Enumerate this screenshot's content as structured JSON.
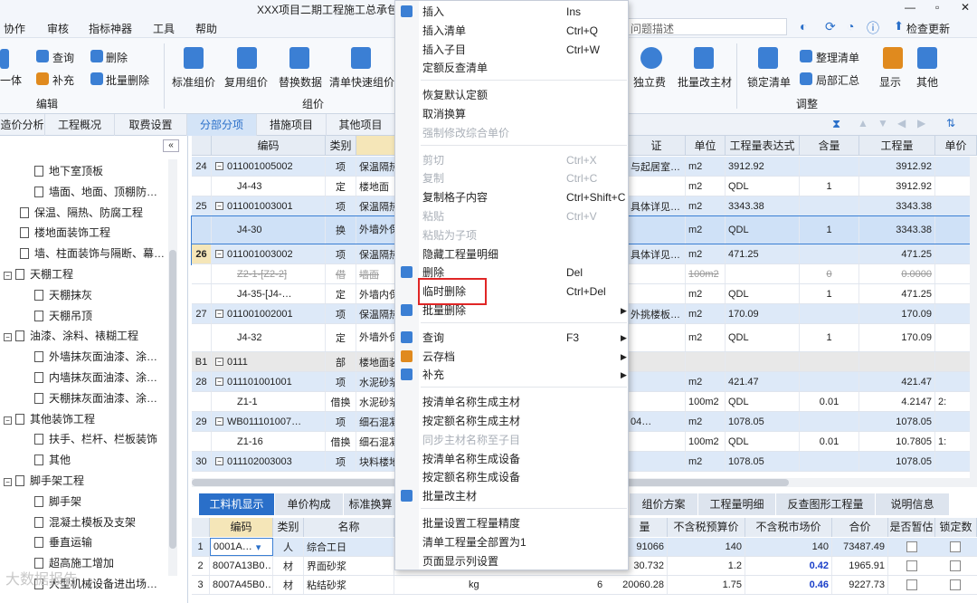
{
  "title": "XXX项目二期工程施工总承包",
  "window_controls": [
    "—",
    "▫",
    "✕"
  ],
  "menubar": {
    "items": [
      "协作",
      "审核",
      "指标神器",
      "工具",
      "帮助"
    ],
    "search_placeholder": "问题描述",
    "check_update": "检查更新"
  },
  "ribbon": {
    "left_group": {
      "query": "查询",
      "delete": "删除",
      "supplement": "补充",
      "batch_delete": "批量删除",
      "one_body": "一体",
      "label": "编辑"
    },
    "mid_group": {
      "std_price": "标准组价",
      "reuse_price": "复用组价",
      "replace_data": "替换数据",
      "quick_price": "清单快速组价",
      "label": "组价"
    },
    "right_group": {
      "independent_fee": "独立费",
      "batch_material": "批量改主材",
      "lock_list": "锁定清单",
      "organize_list": "整理清单",
      "partial_summary": "局部汇总",
      "display": "显示",
      "other": "其他",
      "label": "调整"
    }
  },
  "tabs": [
    "造价分析",
    "工程概况",
    "取费设置",
    "分部分项",
    "措施项目",
    "其他项目"
  ],
  "active_tab": "分部分项",
  "tree": [
    {
      "label": "地下室顶板",
      "level": 2
    },
    {
      "label": "墙面、地面、顶棚防…",
      "level": 2
    },
    {
      "label": "保温、隔热、防腐工程",
      "level": 1
    },
    {
      "label": "楼地面装饰工程",
      "level": 1
    },
    {
      "label": "墙、柱面装饰与隔断、幕…",
      "level": 1
    },
    {
      "label": "天棚工程",
      "level": 0,
      "collapse": "−"
    },
    {
      "label": "天棚抹灰",
      "level": 2
    },
    {
      "label": "天棚吊顶",
      "level": 2
    },
    {
      "label": "油漆、涂料、裱糊工程",
      "level": 0,
      "collapse": "−"
    },
    {
      "label": "外墙抹灰面油漆、涂…",
      "level": 2
    },
    {
      "label": "内墙抹灰面油漆、涂…",
      "level": 2
    },
    {
      "label": "天棚抹灰面油漆、涂…",
      "level": 2
    },
    {
      "label": "其他装饰工程",
      "level": 0,
      "collapse": "−"
    },
    {
      "label": "扶手、栏杆、栏板装饰",
      "level": 2
    },
    {
      "label": "其他",
      "level": 2
    },
    {
      "label": "脚手架工程",
      "level": 0,
      "collapse": "−"
    },
    {
      "label": "脚手架",
      "level": 2
    },
    {
      "label": "混凝土模板及支架",
      "level": 2
    },
    {
      "label": "垂直运输",
      "level": 2
    },
    {
      "label": "超高施工增加",
      "level": 2
    },
    {
      "label": "大型机械设备进出场…",
      "level": 2
    }
  ],
  "grid": {
    "headers": [
      "编码",
      "类别",
      "证",
      "单位",
      "工程量表达式",
      "含量",
      "工程量",
      "单价"
    ],
    "rows": [
      {
        "no": "24",
        "code": "011001005002",
        "type": "项",
        "name": "保温隔热",
        "spec": "与起居室…",
        "unit": "m2",
        "expr": "3912.92",
        "qty_ratio": "",
        "qty": "3912.92",
        "kind": "item",
        "box": "−"
      },
      {
        "no": "",
        "code": "J4-43",
        "type": "定",
        "name": "楼地面",
        "spec": "",
        "unit": "m2",
        "expr": "QDL",
        "qty_ratio": "1",
        "qty": "3912.92",
        "kind": "quota"
      },
      {
        "no": "25",
        "code": "011001003001",
        "type": "项",
        "name": "保温隔热",
        "spec": "具体详见…",
        "unit": "m2",
        "expr": "3343.38",
        "qty_ratio": "",
        "qty": "3343.38",
        "kind": "item",
        "box": "−"
      },
      {
        "no": "",
        "code": "J4-30",
        "type": "换",
        "name": "外墙外保温 格布 单",
        "spec": "",
        "unit": "m2",
        "expr": "QDL",
        "qty_ratio": "1",
        "qty": "3343.38",
        "kind": "selected"
      },
      {
        "no": "26",
        "code": "011001003002",
        "type": "项",
        "name": "保温隔热",
        "spec": "具体详见…",
        "unit": "m2",
        "expr": "471.25",
        "qty_ratio": "",
        "qty": "471.25",
        "kind": "item-current",
        "box": "−"
      },
      {
        "no": "",
        "code": "Z2-1-[Z2-2]",
        "type": "借",
        "name": "墙面",
        "spec": "",
        "unit": "100m2",
        "expr": "",
        "qty_ratio": "0",
        "qty": "0.0000",
        "kind": "struck"
      },
      {
        "no": "",
        "code": "J4-35-[J4-…",
        "type": "定",
        "name": "外墙内保",
        "spec": "",
        "unit": "m2",
        "expr": "QDL",
        "qty_ratio": "1",
        "qty": "471.25",
        "kind": "quota"
      },
      {
        "no": "27",
        "code": "011001002001",
        "type": "项",
        "name": "保温隔热",
        "spec": "外挑楼板…",
        "unit": "m2",
        "expr": "170.09",
        "qty_ratio": "",
        "qty": "170.09",
        "kind": "item",
        "box": "−"
      },
      {
        "no": "",
        "code": "J4-32",
        "type": "定",
        "name": "外墙外保温 电焊网",
        "spec": "",
        "unit": "m2",
        "expr": "QDL",
        "qty_ratio": "1",
        "qty": "170.09",
        "kind": "quota-tall"
      },
      {
        "no": "B1",
        "code": "0111",
        "type": "部",
        "name": "楼地面装",
        "spec": "",
        "unit": "",
        "expr": "",
        "qty_ratio": "",
        "qty": "",
        "kind": "section",
        "box": "−"
      },
      {
        "no": "28",
        "code": "011101001001",
        "type": "项",
        "name": "水泥砂浆",
        "spec": "",
        "unit": "m2",
        "expr": "421.47",
        "qty_ratio": "",
        "qty": "421.47",
        "kind": "item",
        "box": "−"
      },
      {
        "no": "",
        "code": "Z1-1",
        "type": "借换",
        "name": "水泥砂浆",
        "spec": "",
        "unit": "100m2",
        "expr": "QDL",
        "qty_ratio": "0.01",
        "qty": "4.2147",
        "kind": "quota",
        "extra": "2:"
      },
      {
        "no": "29",
        "code": "WB011101007…",
        "type": "项",
        "name": "细石混凝",
        "spec": "04…",
        "unit": "m2",
        "expr": "1078.05",
        "qty_ratio": "",
        "qty": "1078.05",
        "kind": "item",
        "box": "−"
      },
      {
        "no": "",
        "code": "Z1-16",
        "type": "借换",
        "name": "细石混凝",
        "spec": "",
        "unit": "100m2",
        "expr": "QDL",
        "qty_ratio": "0.01",
        "qty": "10.7805",
        "kind": "quota",
        "extra": "1:"
      },
      {
        "no": "30",
        "code": "011102003003",
        "type": "项",
        "name": "块料楼地",
        "spec": "",
        "unit": "m2",
        "expr": "1078.05",
        "qty_ratio": "",
        "qty": "1078.05",
        "kind": "item",
        "box": "−"
      }
    ]
  },
  "context_menu": {
    "items": [
      {
        "label": "插入",
        "shortcut": "Ins",
        "icon": "insert-icon"
      },
      {
        "label": "插入清单",
        "shortcut": "Ctrl+Q"
      },
      {
        "label": "插入子目",
        "shortcut": "Ctrl+W"
      },
      {
        "label": "定额反查清单",
        "shortcut": ""
      },
      {
        "sep": true
      },
      {
        "label": "恢复默认定额",
        "shortcut": ""
      },
      {
        "label": "取消换算",
        "shortcut": ""
      },
      {
        "label": "强制修改综合单价",
        "shortcut": "",
        "disabled": true
      },
      {
        "sep": true
      },
      {
        "label": "剪切",
        "shortcut": "Ctrl+X",
        "disabled": true
      },
      {
        "label": "复制",
        "shortcut": "Ctrl+C",
        "disabled": true
      },
      {
        "label": "复制格子内容",
        "shortcut": "Ctrl+Shift+C"
      },
      {
        "label": "粘贴",
        "shortcut": "Ctrl+V",
        "disabled": true
      },
      {
        "label": "粘贴为子项",
        "shortcut": "",
        "disabled": true
      },
      {
        "label": "隐藏工程量明细",
        "shortcut": ""
      },
      {
        "label": "删除",
        "shortcut": "Del",
        "icon": "delete-icon"
      },
      {
        "label": "临时删除",
        "shortcut": "Ctrl+Del",
        "highlight": true
      },
      {
        "label": "批量删除",
        "shortcut": "",
        "submenu": true,
        "icon": "batch-delete-icon"
      },
      {
        "sep": true
      },
      {
        "label": "查询",
        "shortcut": "F3",
        "submenu": true,
        "icon": "query-icon"
      },
      {
        "label": "云存档",
        "shortcut": "",
        "submenu": true,
        "icon": "cloud-archive-icon"
      },
      {
        "label": "补充",
        "shortcut": "",
        "submenu": true,
        "icon": "supplement-icon"
      },
      {
        "sep": true
      },
      {
        "label": "按清单名称生成主材",
        "shortcut": ""
      },
      {
        "label": "按定额名称生成主材",
        "shortcut": ""
      },
      {
        "label": "同步主材名称至子目",
        "shortcut": "",
        "disabled": true
      },
      {
        "label": "按清单名称生成设备",
        "shortcut": ""
      },
      {
        "label": "按定额名称生成设备",
        "shortcut": ""
      },
      {
        "label": "批量改主材",
        "shortcut": "",
        "icon": "batch-material-icon"
      },
      {
        "sep": true
      },
      {
        "label": "批量设置工程量精度",
        "shortcut": ""
      },
      {
        "label": "清单工程量全部置为1",
        "shortcut": ""
      },
      {
        "label": "页面显示列设置",
        "shortcut": ""
      }
    ]
  },
  "bottom": {
    "tabs": [
      "工料机显示",
      "单价构成",
      "标准换算",
      "组价方案",
      "工程量明细",
      "反查图形工程量",
      "说明信息"
    ],
    "active_tab": "工料机显示",
    "headers": [
      "编码",
      "类别",
      "名称",
      "量",
      "不含税预算价",
      "不含税市场价",
      "合价",
      "是否暂估",
      "锁定数量"
    ],
    "rows": [
      {
        "no": "1",
        "code": "0001A…",
        "type": "人",
        "name": "综合工日",
        "unit": "",
        "qty": "91066",
        "budget": "140",
        "market": "140",
        "total": "73487.49"
      },
      {
        "no": "2",
        "code": "8007A13B0…",
        "type": "材",
        "name": "界面砂浆",
        "unit": "",
        "qty": "30.732",
        "budget": "1.2",
        "market": "0.42",
        "total": "1965.91"
      },
      {
        "no": "3",
        "code": "8007A45B0…",
        "type": "材",
        "name": "粘结砂浆",
        "unit": "kg",
        "qty": "20060.28",
        "budget": "1.75",
        "market": "0.46",
        "total": "9227.73",
        "qty_pre": "6"
      }
    ]
  },
  "watermark": "大数据报告"
}
